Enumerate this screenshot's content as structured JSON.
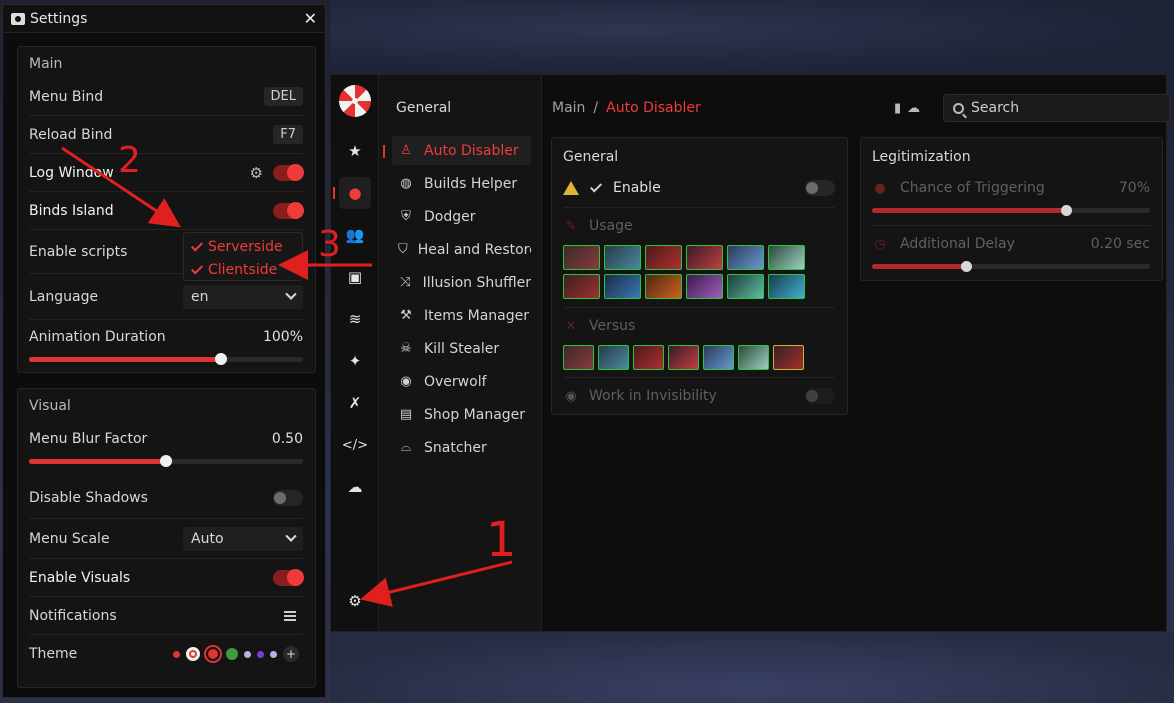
{
  "settings_window": {
    "title": "Settings",
    "main_section": {
      "title": "Main",
      "menu_bind": {
        "label": "Menu Bind",
        "key": "DEL"
      },
      "reload_bind": {
        "label": "Reload Bind",
        "key": "F7"
      },
      "log_window": {
        "label": "Log Window",
        "enabled": true
      },
      "binds_island": {
        "label": "Binds Island",
        "enabled": true
      },
      "enable_scripts": {
        "label": "Enable scripts",
        "options": [
          "Serverside",
          "Clientside"
        ]
      },
      "language": {
        "label": "Language",
        "value": "en"
      },
      "animation_duration": {
        "label": "Animation Duration",
        "value": "100%",
        "level": 0.7
      }
    },
    "visual_section": {
      "title": "Visual",
      "menu_blur_factor": {
        "label": "Menu Blur Factor",
        "value": "0.50",
        "level": 0.5
      },
      "disable_shadows": {
        "label": "Disable Shadows",
        "enabled": false
      },
      "menu_scale": {
        "label": "Menu Scale",
        "value": "Auto"
      },
      "enable_visuals": {
        "label": "Enable Visuals",
        "enabled": true
      },
      "notifications": {
        "label": "Notifications"
      },
      "theme": {
        "label": "Theme",
        "colors": [
          "#e03535",
          "#f0f0f0",
          "#e03535",
          "#3f9a3f",
          "#b4b4e6",
          "#7a3ce0",
          "#b4b4e6"
        ]
      }
    }
  },
  "app": {
    "nav_title": "General",
    "nav_items": [
      {
        "label": "Auto Disabler",
        "icon": "person-icon",
        "active": true
      },
      {
        "label": "Builds Helper",
        "icon": "basketball-icon"
      },
      {
        "label": "Dodger",
        "icon": "shield-icon"
      },
      {
        "label": "Heal and Restore",
        "icon": "shield-heart-icon"
      },
      {
        "label": "Illusion Shuffler",
        "icon": "shuffle-icon"
      },
      {
        "label": "Items Manager",
        "icon": "wrench-icon"
      },
      {
        "label": "Kill Stealer",
        "icon": "skull-icon"
      },
      {
        "label": "Overwolf",
        "icon": "eye-icon"
      },
      {
        "label": "Shop Manager",
        "icon": "shop-icon"
      },
      {
        "label": "Snatcher",
        "icon": "glasses-icon"
      }
    ],
    "sidebar_icons": [
      "star-icon",
      "globe-icon",
      "users-icon",
      "image-icon",
      "swimmer-icon",
      "sparkles-icon",
      "tools-icon",
      "code-icon",
      "cloud-icon",
      "gear-icon"
    ],
    "breadcrumb": {
      "root": "Main",
      "separator": "/",
      "current": "Auto Disabler"
    },
    "search_placeholder": "Search",
    "general_card": {
      "title": "General",
      "enable": {
        "label": "Enable",
        "enabled": false
      },
      "usage_label": "Usage",
      "usage_heroes": 12,
      "versus_label": "Versus",
      "versus_heroes": 7,
      "work_in_invisibility": {
        "label": "Work in Invisibility",
        "enabled": false
      }
    },
    "legit_card": {
      "title": "Legitimization",
      "chance": {
        "label": "Chance of Triggering",
        "value": "70%",
        "level": 0.7
      },
      "delay": {
        "label": "Additional Delay",
        "value": "0.20 sec",
        "level": 0.34
      }
    }
  },
  "annotations": [
    "1",
    "2",
    "3"
  ],
  "colors": {
    "accent": "#ee3b3b",
    "arrow": "#e01f1f"
  }
}
